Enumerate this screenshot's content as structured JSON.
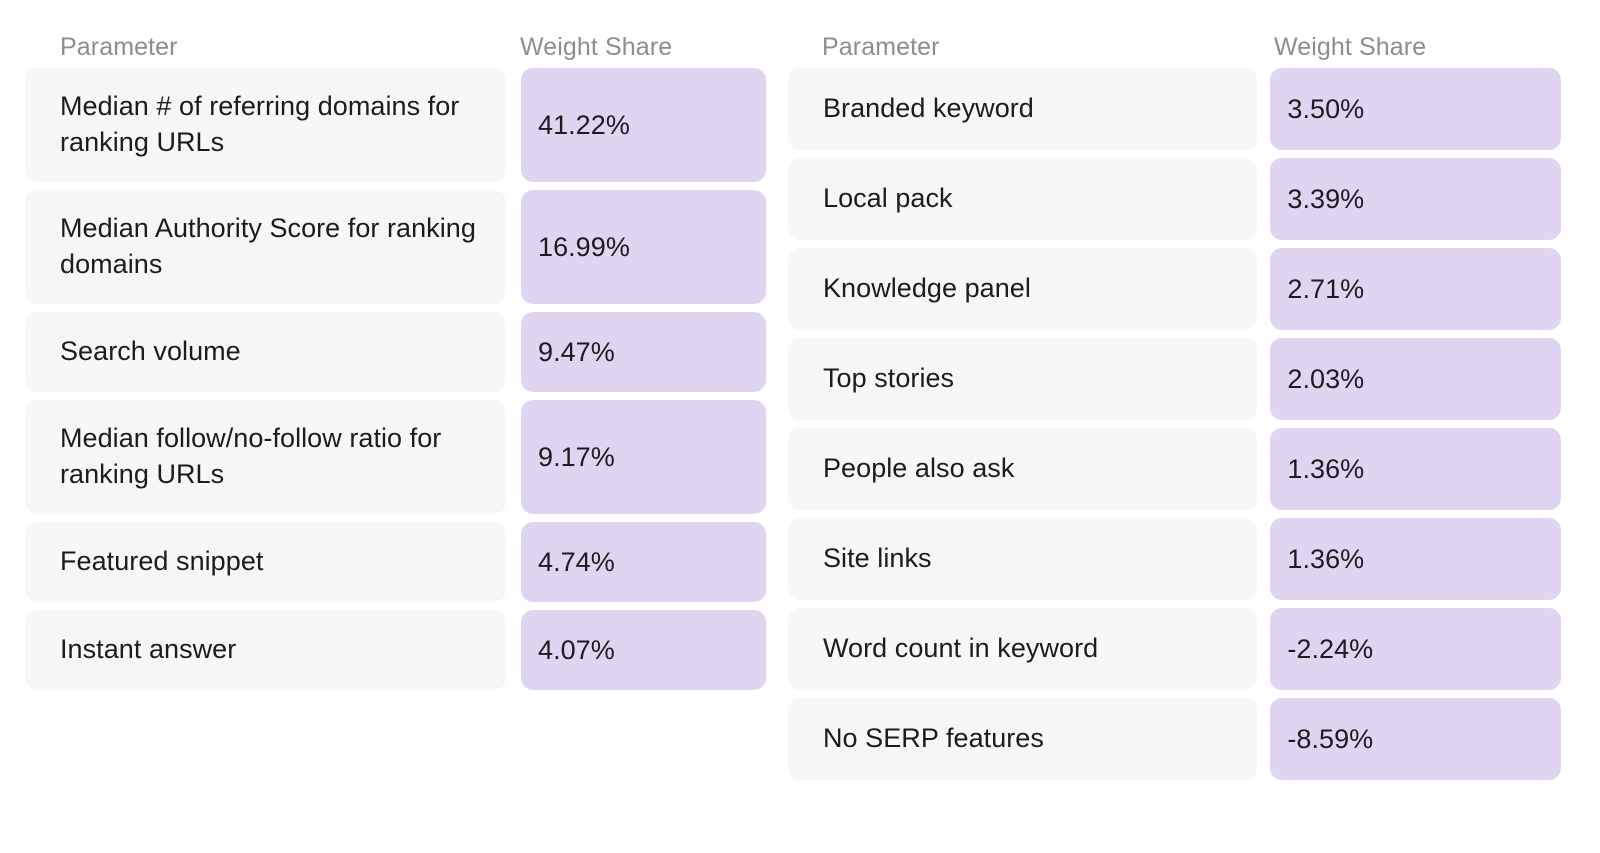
{
  "colors": {
    "row_background": "#F7F7F8",
    "value_background": "#E0D5F0",
    "header_text": "#8D8D95",
    "body_text": "#1B1B20",
    "page_background": "#FFFFFF"
  },
  "tables": [
    {
      "id": "left",
      "headers": {
        "parameter": "Parameter",
        "weight_share": "Weight Share"
      },
      "rows": [
        {
          "parameter": "Median # of referring domains for ranking URLs",
          "weight_share": "41.22%"
        },
        {
          "parameter": "Median Authority Score for ranking domains",
          "weight_share": "16.99%"
        },
        {
          "parameter": "Search volume",
          "weight_share": "9.47%"
        },
        {
          "parameter": "Median follow/no-follow ratio for ranking URLs",
          "weight_share": "9.17%"
        },
        {
          "parameter": "Featured snippet",
          "weight_share": "4.74%"
        },
        {
          "parameter": "Instant answer",
          "weight_share": "4.07%"
        }
      ]
    },
    {
      "id": "right",
      "headers": {
        "parameter": "Parameter",
        "weight_share": "Weight Share"
      },
      "rows": [
        {
          "parameter": "Branded keyword",
          "weight_share": "3.50%"
        },
        {
          "parameter": "Local pack",
          "weight_share": "3.39%"
        },
        {
          "parameter": "Knowledge panel",
          "weight_share": "2.71%"
        },
        {
          "parameter": "Top stories",
          "weight_share": "2.03%"
        },
        {
          "parameter": "People also ask",
          "weight_share": "1.36%"
        },
        {
          "parameter": "Site links",
          "weight_share": "1.36%"
        },
        {
          "parameter": "Word count in keyword",
          "weight_share": "-2.24%"
        },
        {
          "parameter": "No SERP features",
          "weight_share": "-8.59%"
        }
      ]
    }
  ],
  "chart_data": {
    "type": "table",
    "title": "",
    "xlabel": "Parameter",
    "ylabel": "Weight Share",
    "categories": [
      "Median # of referring domains for ranking URLs",
      "Median Authority Score for ranking domains",
      "Search volume",
      "Median follow/no-follow ratio for ranking URLs",
      "Featured snippet",
      "Instant answer",
      "Branded keyword",
      "Local pack",
      "Knowledge panel",
      "Top stories",
      "People also ask",
      "Site links",
      "Word count in keyword",
      "No SERP features"
    ],
    "values": [
      41.22,
      16.99,
      9.47,
      9.17,
      4.74,
      4.07,
      3.5,
      3.39,
      2.71,
      2.03,
      1.36,
      1.36,
      -2.24,
      -8.59
    ],
    "value_labels": [
      "41.22%",
      "16.99%",
      "9.47%",
      "9.17%",
      "4.74%",
      "4.07%",
      "3.50%",
      "3.39%",
      "2.71%",
      "2.03%",
      "1.36%",
      "1.36%",
      "-2.24%",
      "-8.59%"
    ],
    "unit": "%",
    "grid": false,
    "legend": "none"
  }
}
